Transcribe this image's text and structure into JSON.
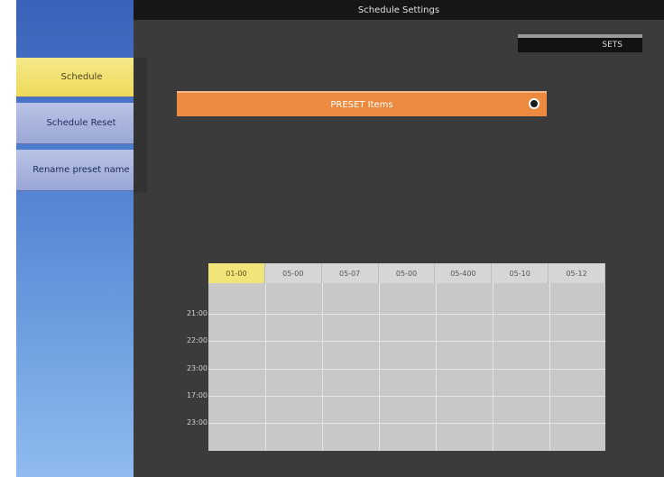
{
  "titlebar": {
    "title": "Schedule Settings"
  },
  "status": {
    "label": "SETS"
  },
  "sidebar": {
    "items": [
      {
        "label": "Schedule",
        "active": true
      },
      {
        "label": "Schedule Reset",
        "active": false
      },
      {
        "label": "Rename preset name",
        "active": false
      }
    ]
  },
  "banner": {
    "label": "PRESET Items"
  },
  "schedule": {
    "days": [
      "01-00",
      "05-00",
      "05-07",
      "05-00",
      "05-400",
      "05-10",
      "05-12"
    ],
    "active_day_index": 0,
    "times": [
      "21:00",
      "22:00",
      "23:00",
      "17:00",
      "23:00"
    ]
  },
  "colors": {
    "sidebar_active": "#f1e57a",
    "banner": "#ee8a3f",
    "panel_bg": "#3b3b3b",
    "titlebar_bg": "#161616"
  }
}
